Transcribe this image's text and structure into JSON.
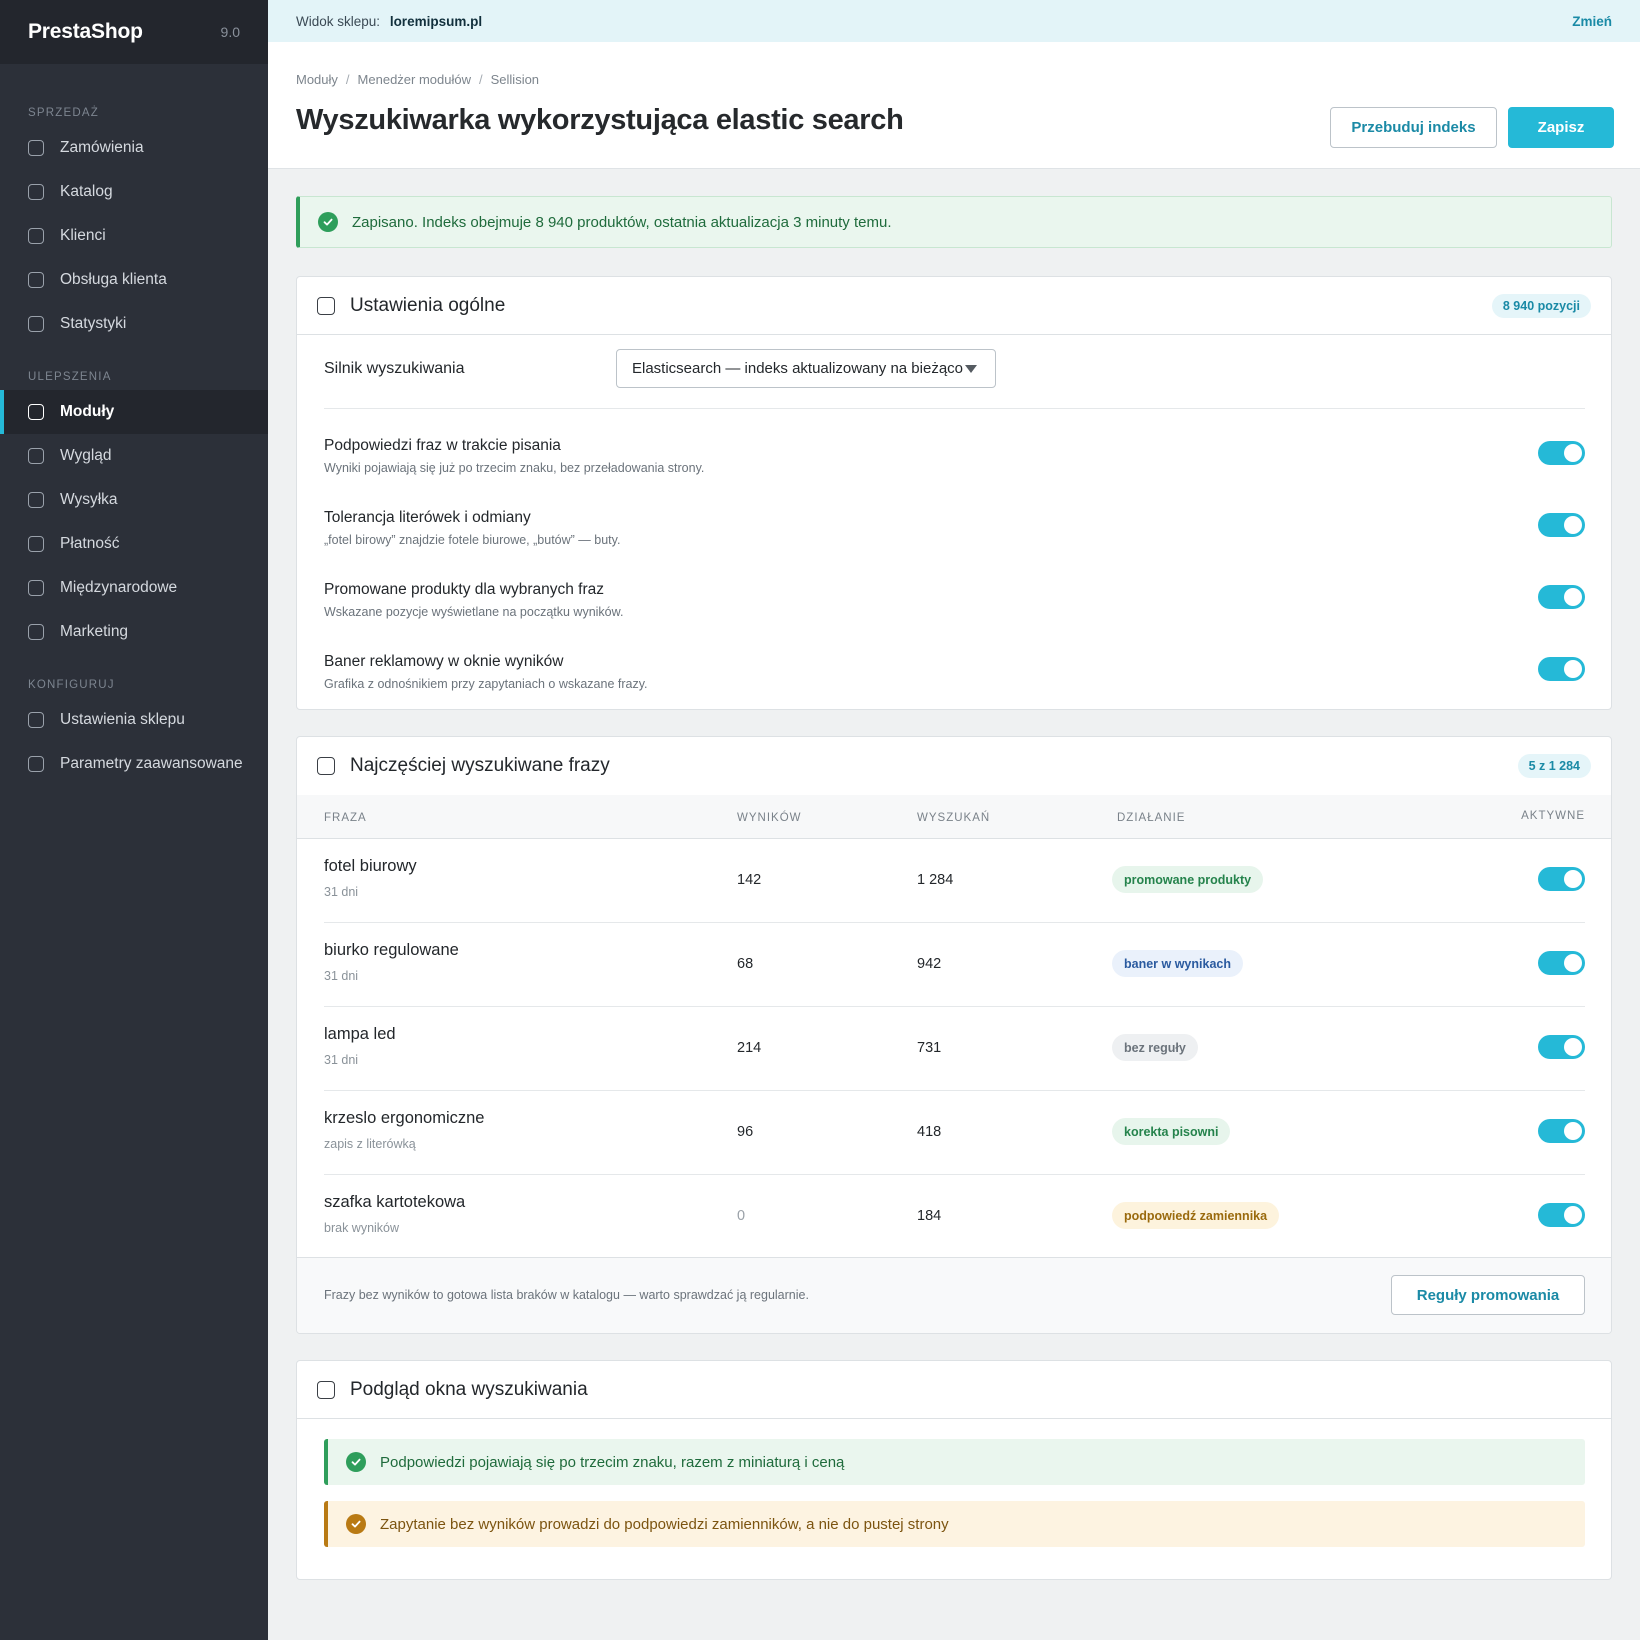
{
  "sidebar": {
    "brand": "PrestaShop",
    "version": "9.0",
    "sections": [
      {
        "title": "SPRZEDAŻ",
        "items": [
          "Zamówienia",
          "Katalog",
          "Klienci",
          "Obsługa klienta",
          "Statystyki"
        ]
      },
      {
        "title": "ULEPSZENIA",
        "items": [
          "Moduły",
          "Wygląd",
          "Wysyłka",
          "Płatność",
          "Międzynarodowe",
          "Marketing"
        ]
      },
      {
        "title": "KONFIGURUJ",
        "items": [
          "Ustawienia sklepu",
          "Parametry zaawansowane"
        ]
      }
    ],
    "active_item": "Moduły"
  },
  "topbar": {
    "shop_label": "Widok sklepu:",
    "shop_url": "loremipsum.pl",
    "change_label": "Zmień"
  },
  "header": {
    "breadcrumb": [
      "Moduły",
      "Menedżer modułów",
      "Sellision"
    ],
    "title": "Wyszukiwarka wykorzystująca elastic search",
    "rebuild_label": "Przebuduj indeks",
    "save_label": "Zapisz"
  },
  "alert": {
    "text": "Zapisano. Indeks obejmuje 8 940 produktów, ostatnia aktualizacja 3 minuty temu."
  },
  "general": {
    "title": "Ustawienia ogólne",
    "badge": "8 940 pozycji",
    "engine_label": "Silnik wyszukiwania",
    "engine_value": "Elasticsearch — indeks aktualizowany na bieżąco",
    "options": [
      {
        "title": "Podpowiedzi fraz w trakcie pisania",
        "desc": "Wyniki pojawiają się już po trzecim znaku, bez przeładowania strony.",
        "enabled": true
      },
      {
        "title": "Tolerancja literówek i odmiany",
        "desc": "„fotel birowy” znajdzie fotele biurowe, „butów” — buty.",
        "enabled": true
      },
      {
        "title": "Promowane produkty dla wybranych fraz",
        "desc": "Wskazane pozycje wyświetlane na początku wyników.",
        "enabled": true
      },
      {
        "title": "Baner reklamowy w oknie wyników",
        "desc": "Grafika z odnośnikiem przy zapytaniach o wskazane frazy.",
        "enabled": true
      }
    ]
  },
  "phrases": {
    "title": "Najczęściej wyszukiwane frazy",
    "badge": "5 z 1 284",
    "columns": [
      "FRAZA",
      "WYNIKÓW",
      "WYSZUKAŃ",
      "DZIAŁANIE",
      "AKTYWNE"
    ],
    "rows": [
      {
        "phrase": "fotel biurowy",
        "sub": "31 dni",
        "results": "142",
        "searches": "1 284",
        "action": "promowane produkty",
        "action_color": "green",
        "active": true
      },
      {
        "phrase": "biurko regulowane",
        "sub": "31 dni",
        "results": "68",
        "searches": "942",
        "action": "baner w wynikach",
        "action_color": "blue",
        "active": true
      },
      {
        "phrase": "lampa led",
        "sub": "31 dni",
        "results": "214",
        "searches": "731",
        "action": "bez reguły",
        "action_color": "gray",
        "active": true
      },
      {
        "phrase": "krzeslo ergonomiczne",
        "sub": "zapis z literówką",
        "results": "96",
        "searches": "418",
        "action": "korekta pisowni",
        "action_color": "green",
        "active": true
      },
      {
        "phrase": "szafka kartotekowa",
        "sub": "brak wyników",
        "results": "0",
        "searches": "184",
        "action": "podpowiedź zamiennika",
        "action_color": "amber",
        "active": true
      }
    ],
    "footer_note": "Frazy bez wyników to gotowa lista braków w katalogu — warto sprawdzać ją regularnie.",
    "rules_label": "Reguły promowania"
  },
  "preview": {
    "title": "Podgląd okna wyszukiwania",
    "ok_text": "Podpowiedzi pojawiają się po trzecim znaku, razem z miniaturą i ceną",
    "warn_text": "Zapytanie bez wyników prowadzi do podpowiedzi zamienników, a nie do pustej strony"
  },
  "colors": {
    "accent": "#25b9d7",
    "sidebar_bg": "#2c3039",
    "success": "#2f9e5b",
    "warning": "#b97a14"
  }
}
